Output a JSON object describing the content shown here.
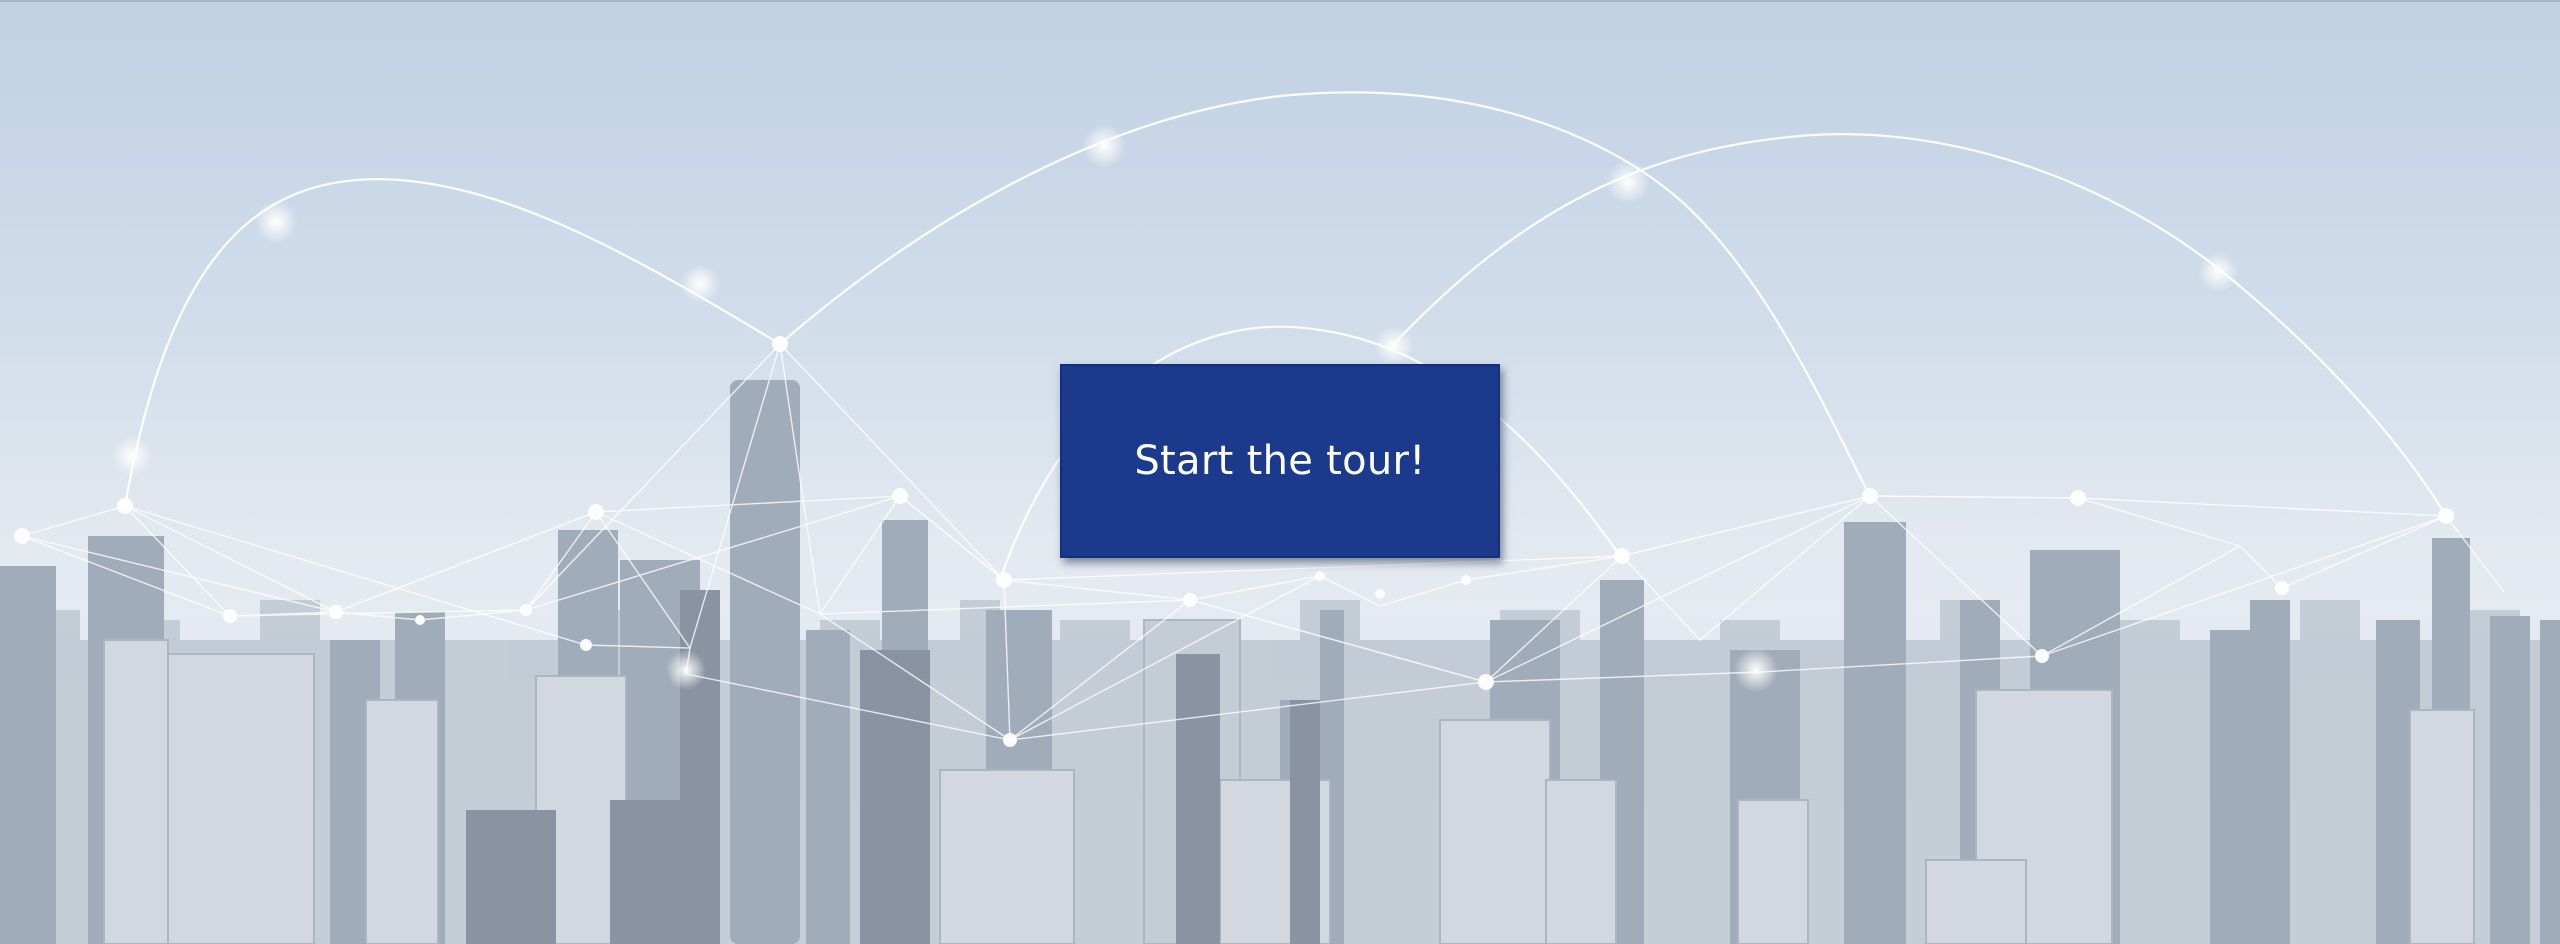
{
  "hero": {
    "cta_label": "Start the tour!"
  },
  "colors": {
    "cta_background": "#1c3a8c",
    "cta_text": "#ffffff",
    "sky_top": "#b3c7de",
    "sky_bottom": "#e8ecf1"
  },
  "background": {
    "image": "city-skyline-network",
    "icon": "network-connections"
  }
}
